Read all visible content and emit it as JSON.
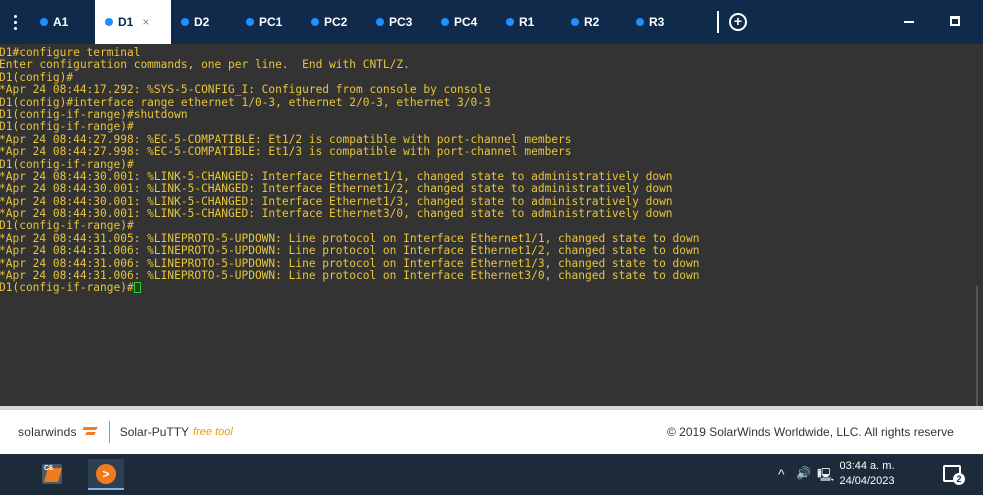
{
  "tabs": [
    {
      "label": "A1",
      "active": false
    },
    {
      "label": "D1",
      "active": true,
      "close": "×"
    },
    {
      "label": "D2",
      "active": false
    },
    {
      "label": "PC1",
      "active": false
    },
    {
      "label": "PC2",
      "active": false
    },
    {
      "label": "PC3",
      "active": false
    },
    {
      "label": "PC4",
      "active": false
    },
    {
      "label": "R1",
      "active": false
    },
    {
      "label": "R2",
      "active": false
    },
    {
      "label": "R3",
      "active": false
    }
  ],
  "icons": {
    "menu": "kebab-menu-icon",
    "add_tab": "plus-circle-icon",
    "minimize": "minimize-icon",
    "maximize": "maximize-icon"
  },
  "colors": {
    "tabbar_bg": "#0f2a4a",
    "terminal_bg": "#333333",
    "terminal_text": "#e8c53a",
    "tab_dot": "#1e90ff",
    "cursor": "#2bd12b",
    "brand_orange": "#f47b20"
  },
  "terminal": {
    "lines": [
      "D1#configure terminal",
      "Enter configuration commands, one per line.  End with CNTL/Z.",
      "D1(config)#",
      "*Apr 24 08:44:17.292: %SYS-5-CONFIG_I: Configured from console by console",
      "D1(config)#interface range ethernet 1/0-3, ethernet 2/0-3, ethernet 3/0-3",
      "D1(config-if-range)#shutdown",
      "D1(config-if-range)#",
      "*Apr 24 08:44:27.998: %EC-5-COMPATIBLE: Et1/2 is compatible with port-channel members",
      "*Apr 24 08:44:27.998: %EC-5-COMPATIBLE: Et1/3 is compatible with port-channel members",
      "D1(config-if-range)#",
      "*Apr 24 08:44:30.001: %LINK-5-CHANGED: Interface Ethernet1/1, changed state to administratively down",
      "*Apr 24 08:44:30.001: %LINK-5-CHANGED: Interface Ethernet1/2, changed state to administratively down",
      "*Apr 24 08:44:30.001: %LINK-5-CHANGED: Interface Ethernet1/3, changed state to administratively down",
      "*Apr 24 08:44:30.001: %LINK-5-CHANGED: Interface Ethernet3/0, changed state to administratively down",
      "D1(config-if-range)#",
      "*Apr 24 08:44:31.005: %LINEPROTO-5-UPDOWN: Line protocol on Interface Ethernet1/1, changed state to down",
      "*Apr 24 08:44:31.006: %LINEPROTO-5-UPDOWN: Line protocol on Interface Ethernet1/2, changed state to down",
      "*Apr 24 08:44:31.006: %LINEPROTO-5-UPDOWN: Line protocol on Interface Ethernet1/3, changed state to down",
      "*Apr 24 08:44:31.006: %LINEPROTO-5-UPDOWN: Line protocol on Interface Ethernet3/0, changed state to down"
    ],
    "prompt": "D1(config-if-range)#"
  },
  "footer": {
    "brand": "solarwinds",
    "product": "Solar-PuTTY",
    "free_label": "free tool",
    "copyright": "© 2019 SolarWinds Worldwide, LLC. All rights reserve"
  },
  "taskbar": {
    "app1_badge": "C6",
    "app2_icon": ">",
    "tray_chevron": "^",
    "tray_volume": "🔊",
    "tray_network": "🖳",
    "time": "03:44 a. m.",
    "date": "24/04/2023",
    "notifications_count": "2"
  }
}
